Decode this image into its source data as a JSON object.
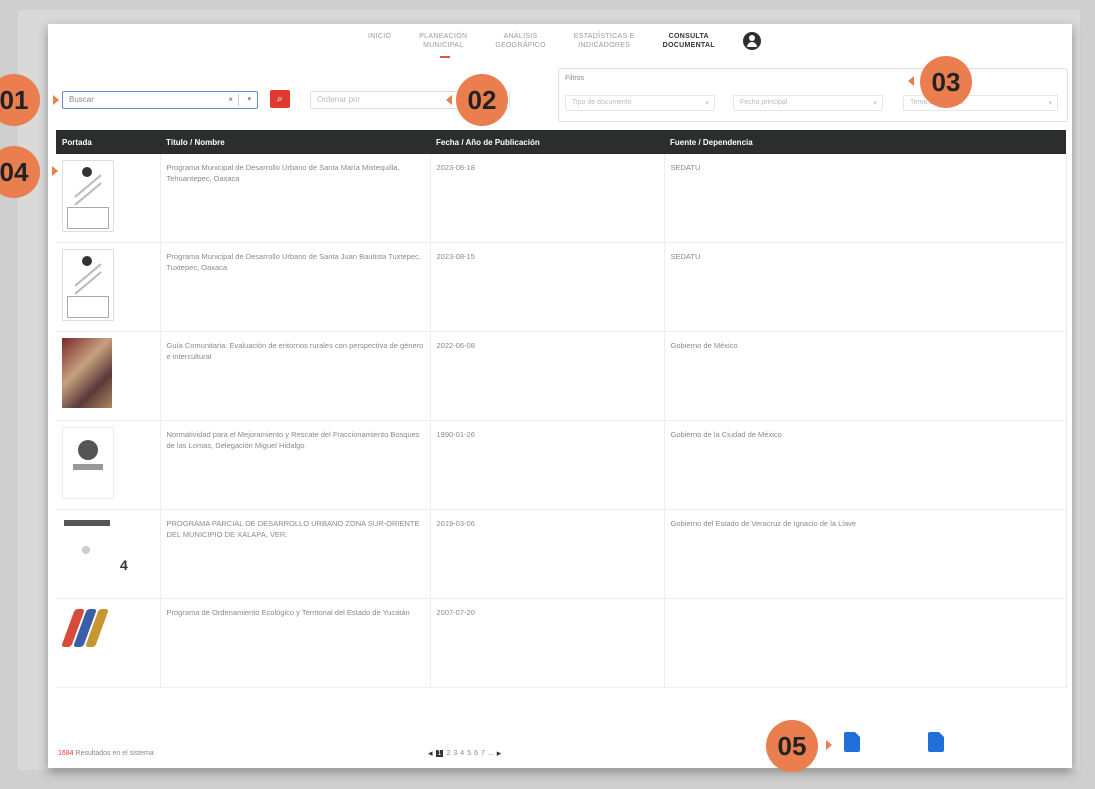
{
  "nav": {
    "items": [
      {
        "label": "INICIO",
        "active": false
      },
      {
        "label": "PLANEACIÓN\nMUNICIPAL",
        "active": false
      },
      {
        "label": "ANÁLISIS\nGEOGRÁFICO",
        "active": false
      },
      {
        "label": "ESTADÍSTICAS E\nINDICADORES",
        "active": false
      },
      {
        "label": "CONSULTA\nDOCUMENTAL",
        "active": true
      }
    ],
    "avatar_icon": "user-circle-icon"
  },
  "search": {
    "value": "Buscar",
    "clear_icon": "x-icon",
    "dropdown_icon": "chevron-down-icon",
    "button_icon": "search-icon"
  },
  "order": {
    "placeholder": "Ordenar por"
  },
  "filters": {
    "title": "Filtros",
    "selects": [
      "Tipo de documento",
      "Fecha principal",
      "Tema documento"
    ]
  },
  "table": {
    "headers": [
      "Portada",
      "Título / Nombre",
      "Fecha / Año de Publicación",
      "Fuente / Dependencia"
    ],
    "rows": [
      {
        "cover": "document-scan",
        "title": "Programa Municipal de Desarrollo Urbano de Santa María Mixtequilla, Tehuantepec, Oaxaca",
        "date": "2023-08-18",
        "source": "SEDATU"
      },
      {
        "cover": "document-scan",
        "title": "Programa Municipal de Desarrollo Urbano de Santa Juan Bautista Tuxtepec, Tuxtepec, Oaxaca",
        "date": "2023-08-15",
        "source": "SEDATU"
      },
      {
        "cover": "photo",
        "title": "Guía Comunitaria: Evaluación de entornos rurales con perspectiva de género e intercultural",
        "date": "2022-06-08",
        "source": "Gobierno de México"
      },
      {
        "cover": "gov-emblem",
        "title": "Normatividad para el Mejoramiento y Rescate del Fraccionamiento Bosques de las Lomas, Delegación Miguel Hidalgo",
        "date": "1990-01-26",
        "source": "Gobierno de la Ciudad de México"
      },
      {
        "cover": "plan",
        "title": "PROGRAMA PARCIAL DE DESARROLLO URBANO ZONA SUR-ORIENTE DEL MUNICIPIO DE XALAPA, VER.",
        "date": "2019-03-06",
        "source": "Gobierno del Estado de Veracruz de Ignacio de la Llave"
      },
      {
        "cover": "yucatan",
        "title": "Programa de Ordenamiento Ecológico y Territorial del Estado de Yucatán",
        "date": "2007-07-20",
        "source": ""
      }
    ]
  },
  "footer": {
    "count": "1684",
    "results_label": "Resultados en el sistema",
    "pages": [
      "1",
      "2",
      "3",
      "4",
      "5",
      "6",
      "7",
      "..."
    ],
    "current_page": "1",
    "prev_icon": "arrow-left-icon",
    "next_icon": "arrow-right-icon",
    "downloads": [
      {
        "icon": "csv-file-icon",
        "color": "#1e6fd9"
      },
      {
        "icon": "pdf-file-icon",
        "color": "#1e6fd9"
      }
    ]
  },
  "stray_text": "4",
  "callouts": [
    "01",
    "02",
    "03",
    "04",
    "05"
  ],
  "colors": {
    "accent": "#e03a2f",
    "callout": "#ea7e4e",
    "header_bg": "#2b2d2f"
  }
}
